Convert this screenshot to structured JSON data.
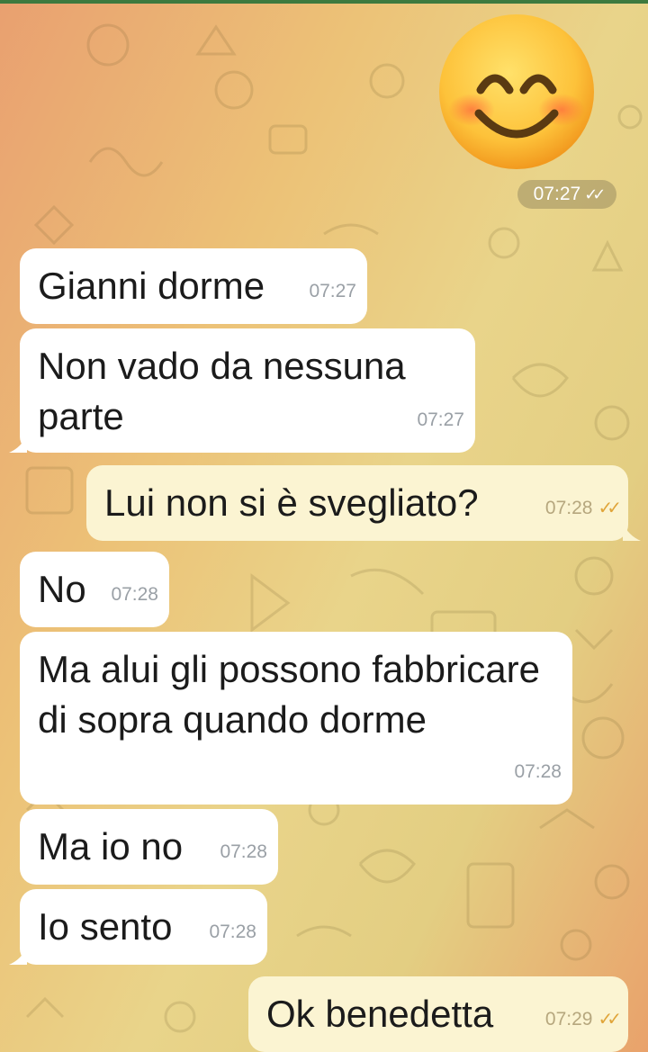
{
  "sticker": {
    "emoji_name": "smiling-face-with-smiling-eyes",
    "time": "07:27",
    "status_icon": "double-check-icon"
  },
  "messages": [
    {
      "direction": "in",
      "text": "Gianni dorme",
      "time": "07:27"
    },
    {
      "direction": "in",
      "text": "Non vado da nessuna parte",
      "time": "07:27"
    },
    {
      "direction": "out",
      "text": "Lui non si è svegliato?",
      "time": "07:28",
      "status_icon": "double-check-icon"
    },
    {
      "direction": "in",
      "text": "No",
      "time": "07:28"
    },
    {
      "direction": "in",
      "text": "Ma alui gli possono fabbricare di sopra quando dorme",
      "time": "07:28"
    },
    {
      "direction": "in",
      "text": "Ma io no",
      "time": "07:28"
    },
    {
      "direction": "in",
      "text": "Io sento",
      "time": "07:28"
    },
    {
      "direction": "out",
      "text": "Ok benedetta",
      "time": "07:29",
      "status_icon": "double-check-icon"
    }
  ],
  "colors": {
    "incoming_bubble": "#ffffff",
    "outgoing_bubble": "#fbf4d2",
    "read_ticks": "#e0a53a",
    "top_bar": "#3d7a3f"
  }
}
